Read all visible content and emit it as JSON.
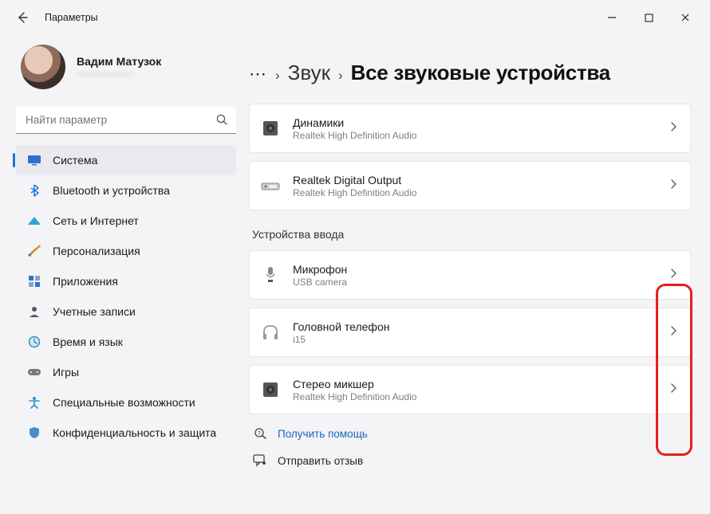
{
  "window": {
    "title": "Параметры"
  },
  "profile": {
    "name": "Вадим Матузок",
    "email": "——————"
  },
  "search": {
    "placeholder": "Найти параметр"
  },
  "sidebar": {
    "items": [
      {
        "label": "Система"
      },
      {
        "label": "Bluetooth и устройства"
      },
      {
        "label": "Сеть и Интернет"
      },
      {
        "label": "Персонализация"
      },
      {
        "label": "Приложения"
      },
      {
        "label": "Учетные записи"
      },
      {
        "label": "Время и язык"
      },
      {
        "label": "Игры"
      },
      {
        "label": "Специальные возможности"
      },
      {
        "label": "Конфиденциальность и защита"
      }
    ]
  },
  "breadcrumb": {
    "parent": "Звук",
    "current": "Все звуковые устройства"
  },
  "output_devices": [
    {
      "title": "Динамики",
      "sub": "Realtek High Definition Audio"
    },
    {
      "title": "Realtek Digital Output",
      "sub": "Realtek High Definition Audio"
    }
  ],
  "input_section_label": "Устройства ввода",
  "input_devices": [
    {
      "title": "Микрофон",
      "sub": "USB camera"
    },
    {
      "title": "Головной телефон",
      "sub": "i15"
    },
    {
      "title": "Стерео микшер",
      "sub": "Realtek High Definition Audio"
    }
  ],
  "help": {
    "get_help": "Получить помощь",
    "feedback": "Отправить отзыв"
  }
}
